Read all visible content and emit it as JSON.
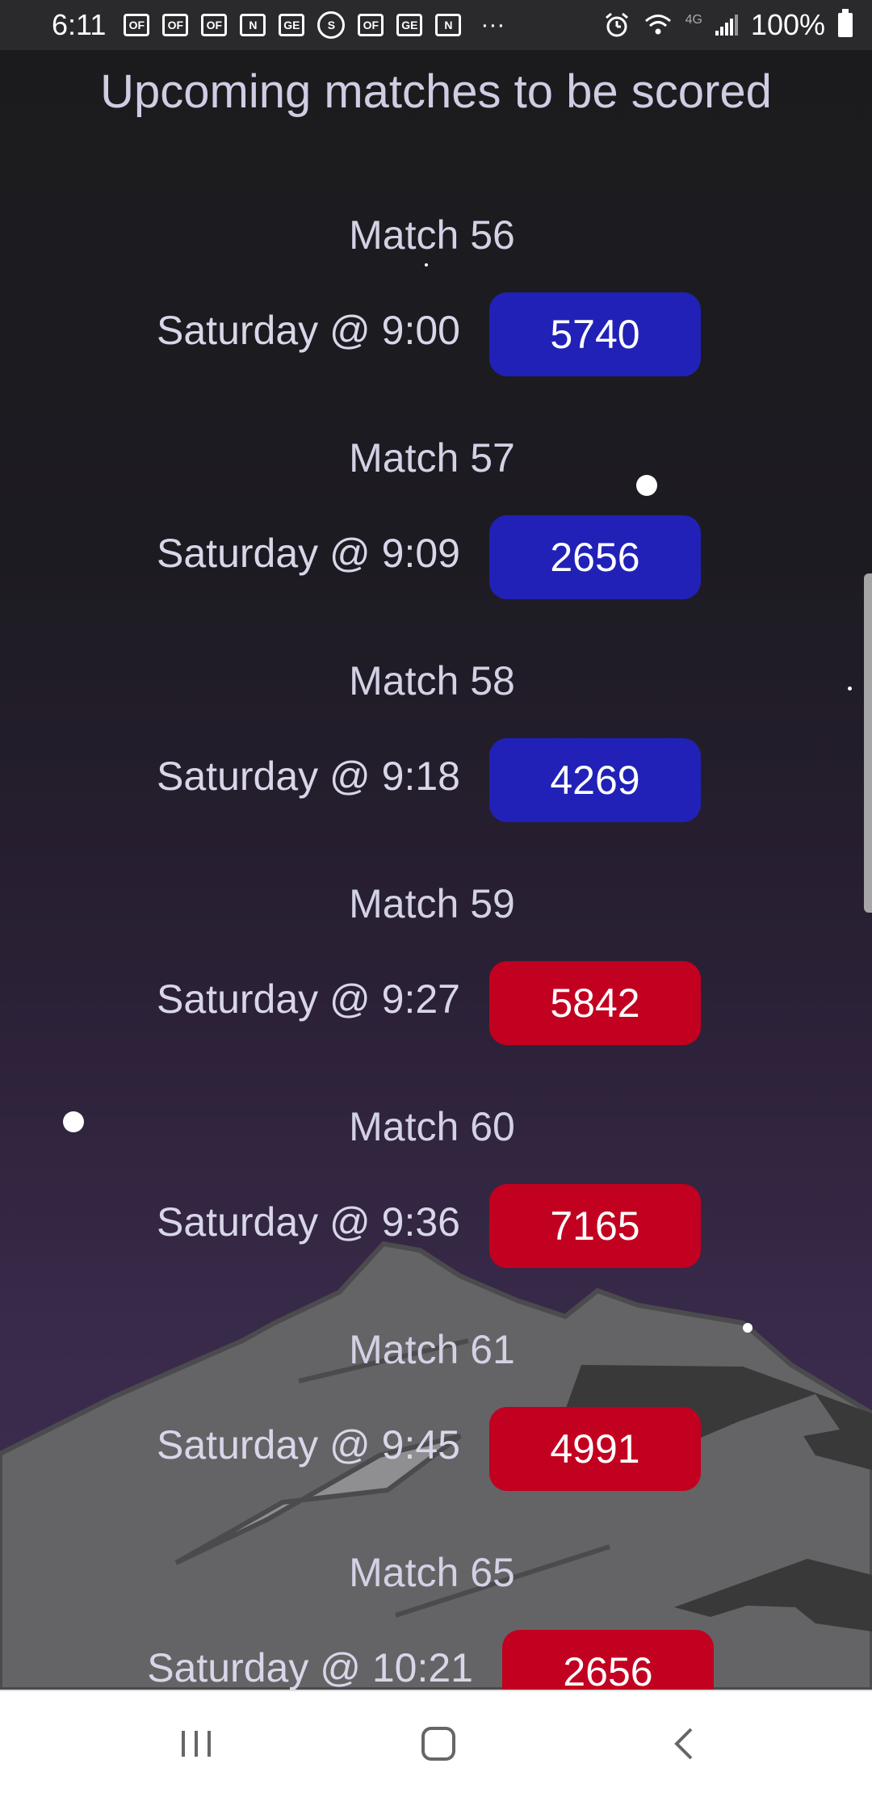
{
  "status_bar": {
    "time": "6:11",
    "notification_icons": [
      "of-icon",
      "of-icon",
      "of-icon",
      "nfl-icon",
      "ge-icon",
      "sync-icon",
      "of-icon",
      "ge-icon",
      "nfl-icon"
    ],
    "more": "···",
    "battery": "100%",
    "network": "4G"
  },
  "page": {
    "title": "Upcoming matches to be scored"
  },
  "matches": [
    {
      "title": "Match 56",
      "time": "Saturday @ 9:00",
      "team": "5740",
      "alliance": "blue"
    },
    {
      "title": "Match 57",
      "time": "Saturday @ 9:09",
      "team": "2656",
      "alliance": "blue"
    },
    {
      "title": "Match 58",
      "time": "Saturday @ 9:18",
      "team": "4269",
      "alliance": "blue"
    },
    {
      "title": "Match 59",
      "time": "Saturday @ 9:27",
      "team": "5842",
      "alliance": "red"
    },
    {
      "title": "Match 60",
      "time": "Saturday @ 9:36",
      "team": "7165",
      "alliance": "red"
    },
    {
      "title": "Match 61",
      "time": "Saturday @ 9:45",
      "team": "4991",
      "alliance": "red"
    },
    {
      "title": "Match 65",
      "time": "Saturday @ 10:21",
      "team": "2656",
      "alliance": "red"
    }
  ],
  "colors": {
    "blue_alliance": "#2121b8",
    "red_alliance": "#c20020"
  },
  "nav_bar": {
    "recents": "recents-icon",
    "home": "home-icon",
    "back": "back-icon"
  }
}
